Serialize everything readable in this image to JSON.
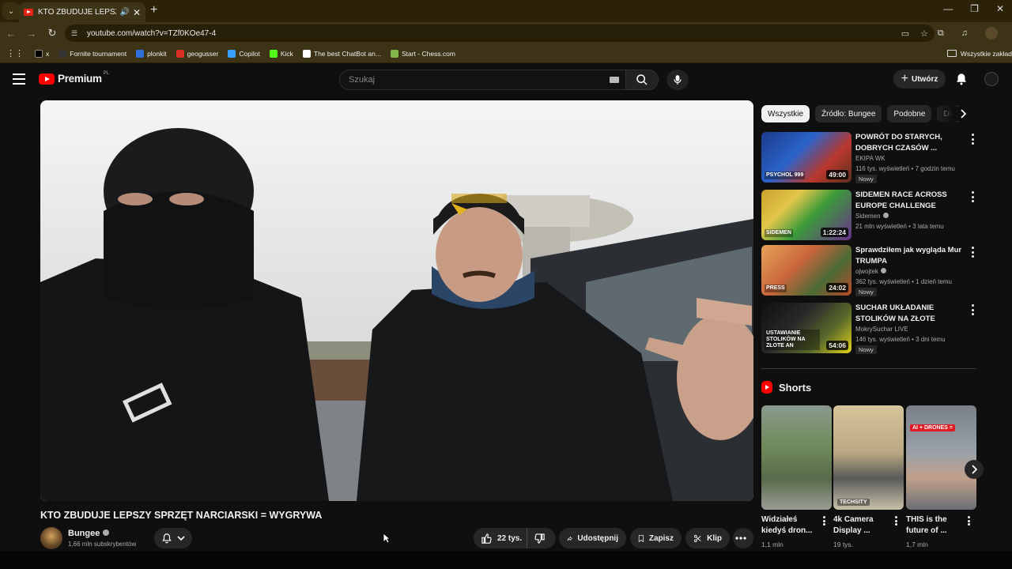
{
  "browser": {
    "tab_title": "KTO ZBUDUJE LEPSZY SPRZ",
    "url": "youtube.com/watch?v=TZf0KOe47-4",
    "bookmarks": [
      {
        "label": "x",
        "icon": "x-logo-icon"
      },
      {
        "label": "Fornite tournament",
        "icon": "game-icon"
      },
      {
        "label": "plonkit",
        "icon": "plonkit-icon"
      },
      {
        "label": "geogusser",
        "icon": "pin-icon"
      },
      {
        "label": "Copilot",
        "icon": "copilot-icon"
      },
      {
        "label": "Kick",
        "icon": "kick-icon"
      },
      {
        "label": "The best ChatBot an...",
        "icon": "chatbot-icon"
      },
      {
        "label": "Start - Chess.com",
        "icon": "chess-icon"
      }
    ],
    "bookmarks_folder": "Wszystkie zakład"
  },
  "header": {
    "logo_text": "Premium",
    "country_code": "PL",
    "search_placeholder": "Szukaj",
    "create_label": "Utwórz"
  },
  "video": {
    "title": "KTO ZBUDUJE LEPSZY SPRZĘT NARCIARSKI = WYGRYWA",
    "channel": "Bungee",
    "subscribers": "1,66 mln subskrybentów",
    "likes": "22 tys.",
    "share_label": "Udostępnij",
    "save_label": "Zapisz",
    "clip_label": "Klip"
  },
  "sidebar": {
    "chips": [
      "Wszystkie",
      "Źródło: Bungee",
      "Podobne",
      "Dla"
    ],
    "recommendations": [
      {
        "title": "POWRÓT DO STARYCH, DOBRYCH CZASÓW ...",
        "channel": "EKIPA WK",
        "verified": false,
        "meta": "116 tys. wyświetleń • 7 godzin temu",
        "badge": "Nowy",
        "duration": "49:00",
        "thumb_text": "PSYCHOL 999"
      },
      {
        "title": "SIDEMEN RACE ACROSS EUROPE CHALLENGE",
        "channel": "Sidemen",
        "verified": true,
        "meta": "21 mln wyświetleń • 3 lata temu",
        "badge": "",
        "duration": "1:22:24",
        "thumb_text": "SIDEMEN"
      },
      {
        "title": "Sprawdziłem jak wygląda Mur TRUMPA",
        "channel": "ojwojtek",
        "verified": true,
        "meta": "362 tys. wyświetleń • 1 dzień temu",
        "badge": "Nowy",
        "duration": "24:02",
        "thumb_text": "PRESS"
      },
      {
        "title": "SUCHAR UKŁADANIE STOLIKÓW NA ZŁOTE ANTOSI...",
        "channel": "MokrySuchar LIVE",
        "verified": false,
        "meta": "146 tys. wyświetleń • 3 dni temu",
        "badge": "Nowy",
        "duration": "54:06",
        "thumb_text": "USTAWIANIE STOLIKÓW NA ZŁOTE AN"
      }
    ],
    "shorts_label": "Shorts",
    "shorts": [
      {
        "title": "Widziałeś kiedyś dron...",
        "views": "1,1 mln",
        "thumb_text": ""
      },
      {
        "title": "4k Camera Display ...",
        "views": "19 tys.",
        "thumb_text": "TECHSITY"
      },
      {
        "title": "THIS is the future of ...",
        "views": "1,7 mln",
        "thumb_text": "AI + DRONES ="
      }
    ]
  },
  "colors": {
    "background": "#0f0f0f",
    "browser_frame": "#3d3417",
    "brand_red": "#ff0000"
  }
}
